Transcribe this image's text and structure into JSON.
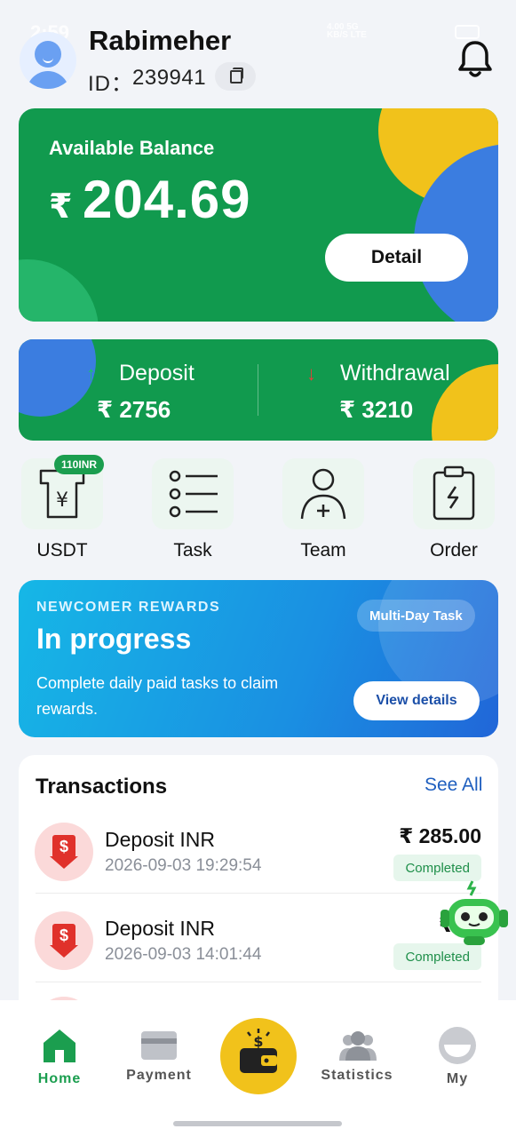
{
  "status_bar": {
    "time": "2:59",
    "network": "4.00 5G\nKB/S LTE"
  },
  "user": {
    "name": "Rabimeher",
    "id_label": "ID：",
    "id": "239941"
  },
  "balance": {
    "label": "Available Balance",
    "currency": "₹",
    "amount": "204.69",
    "detail_label": "Detail"
  },
  "deposit": {
    "arrow": "↑",
    "label": "Deposit",
    "value": "₹ 2756"
  },
  "withdrawal": {
    "arrow": "↓",
    "label": "Withdrawal",
    "value": "₹ 3210"
  },
  "quick_actions": [
    {
      "label": "USDT",
      "badge": "110INR",
      "icon": "usdt-icon"
    },
    {
      "label": "Task",
      "icon": "task-list-icon"
    },
    {
      "label": "Team",
      "icon": "team-add-icon"
    },
    {
      "label": "Order",
      "icon": "order-clipboard-icon"
    }
  ],
  "rewards": {
    "eyebrow": "NEWCOMER REWARDS",
    "title": "In progress",
    "description": "Complete daily paid tasks to claim rewards.",
    "pill": "Multi-Day Task",
    "button": "View details"
  },
  "transactions": {
    "title": "Transactions",
    "see_all": "See All",
    "items": [
      {
        "name": "Deposit INR",
        "date": "2026-09-03 19:29:54",
        "amount": "₹ 285.00",
        "status": "Completed"
      },
      {
        "name": "Deposit INR",
        "date": "2026-09-03 14:01:44",
        "amount": "₹ 35",
        "status": "Completed"
      }
    ]
  },
  "nav": {
    "items": [
      {
        "label": "Home",
        "icon": "home-icon",
        "active": true
      },
      {
        "label": "Payment",
        "icon": "payment-card-icon"
      },
      {
        "label": "",
        "icon": "wallet-icon"
      },
      {
        "label": "Statistics",
        "icon": "statistics-people-icon"
      },
      {
        "label": "My",
        "icon": "profile-icon"
      }
    ]
  },
  "colors": {
    "brand_green": "#119a4e",
    "accent_yellow": "#f1c21b",
    "accent_blue": "#3b7de0",
    "link_blue": "#1f5fbf",
    "danger_red": "#e0312b"
  }
}
